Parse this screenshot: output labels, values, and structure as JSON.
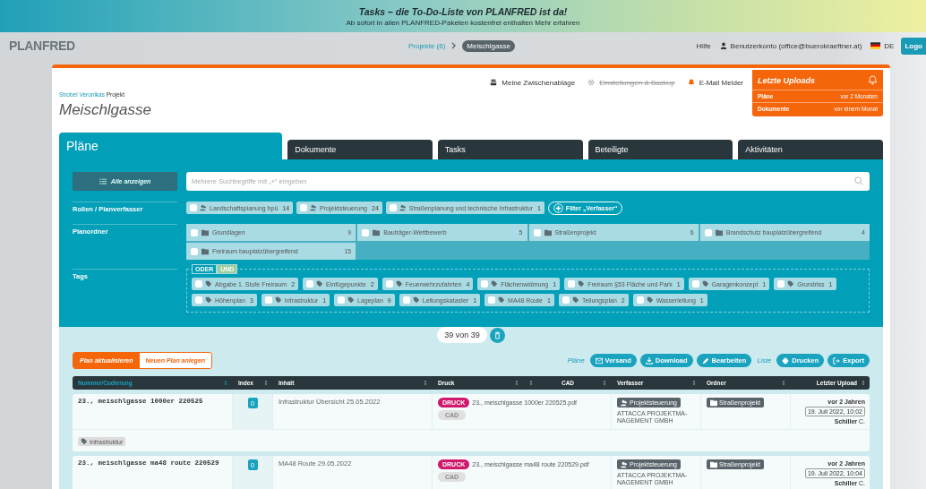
{
  "banner": {
    "title": "Tasks – die To-Do-Liste von PLANFRED ist da!",
    "text": "Ab sofort in allen PLANFRED-Paketen kostenfrei enthalten",
    "link": "Mehr erfahren"
  },
  "header": {
    "logo": "PLANFRED",
    "breadcrumb": {
      "link": "Projekte (6)",
      "current": "Meischlgasse"
    },
    "help": "Hilfe",
    "account": "Benutzerkonto (office@buerokraeftner.at)",
    "language": "DE",
    "logout": "Logo"
  },
  "toolbar": [
    {
      "label": "Meine Zwischenablage",
      "kind": "clipboard",
      "disabled": false
    },
    {
      "label": "Einstellungen & Backup",
      "kind": "gear",
      "disabled": true
    },
    {
      "label": "E-Mail Melder",
      "kind": "bell",
      "disabled": false
    }
  ],
  "uploads": {
    "title": "Letzte Uploads",
    "rows": [
      {
        "label": "Pläne",
        "value": "vor 2 Monaten"
      },
      {
        "label": "Dokumente",
        "value": "vor einem Monat"
      }
    ]
  },
  "project": {
    "owner": "Strobel Veronikas",
    "suffix": "Projekt",
    "title": "Meischlgasse"
  },
  "tabs": [
    {
      "label": "Pläne",
      "selected": true
    },
    {
      "label": "Dokumente",
      "selected": false
    },
    {
      "label": "Tasks",
      "selected": false
    },
    {
      "label": "Beteiligte",
      "selected": false
    },
    {
      "label": "Aktivitäten",
      "selected": false
    }
  ],
  "filters": {
    "show_all": "Alle anzeigen",
    "search": {
      "placeholder": "Mehrere Suchbegriffe mit „+“ eingeben"
    },
    "roles_label": "Rollen / Planverfasser",
    "roles": [
      {
        "label": "Landschaftsplanung bpü",
        "count": "14",
        "checked": false
      },
      {
        "label": "Projektsteuerung",
        "count": "24",
        "checked": false
      },
      {
        "label": "Straßenplanung und technische Infrastruktur",
        "count": "1",
        "checked": false
      }
    ],
    "roles_filter": "Filter „Verfasser“",
    "folders_label": "Planordner",
    "folders": [
      {
        "label": "Grundlagen",
        "count": "9",
        "checked": false
      },
      {
        "label": "Bauträger-Wettbewerb",
        "count": "5",
        "checked": false
      },
      {
        "label": "Straßenprojekt",
        "count": "6",
        "checked": false
      },
      {
        "label": "Brandschutz bauplatzübergreifend",
        "count": "4",
        "checked": false
      },
      {
        "label": "Freiraum bauplatzübergreifend",
        "count": "15",
        "checked": false
      }
    ],
    "tags_label": "Tags",
    "tag_modes": [
      {
        "label": "ODER",
        "selected": false
      },
      {
        "label": "UND",
        "selected": true
      }
    ],
    "tags": [
      {
        "label": "Abgabe 1. Stufe Freiraum",
        "count": "2",
        "checked": false
      },
      {
        "label": "Einfügepunkte",
        "count": "2",
        "checked": false
      },
      {
        "label": "Feuerwehrzufahrten",
        "count": "4",
        "checked": false
      },
      {
        "label": "Flächenwidmung",
        "count": "1",
        "checked": false
      },
      {
        "label": "Freiraum §53 Fläche und Park",
        "count": "1",
        "checked": false
      },
      {
        "label": "Garagenkonzept",
        "count": "1",
        "checked": false
      },
      {
        "label": "Grundriss",
        "count": "1",
        "checked": false
      },
      {
        "label": "Höhenplan",
        "count": "3",
        "checked": false
      },
      {
        "label": "Infrastruktur",
        "count": "1",
        "checked": false
      },
      {
        "label": "Lageplan",
        "count": "9",
        "checked": false
      },
      {
        "label": "Leitungskataster",
        "count": "1",
        "checked": false
      },
      {
        "label": "MA48 Route",
        "count": "1",
        "checked": false
      },
      {
        "label": "Teilungsplan",
        "count": "2",
        "checked": false
      },
      {
        "label": "Wasserleitung",
        "count": "1",
        "checked": false
      }
    ]
  },
  "result_count": "39 von 39",
  "plan_actions": [
    {
      "label": "Plan aktualisieren",
      "selected": true
    },
    {
      "label": "Neuen Plan anlegen",
      "selected": false
    }
  ],
  "action_groups": [
    {
      "label": "Pläne",
      "buttons": [
        {
          "label": "Versand",
          "kind": "mail"
        },
        {
          "label": "Download",
          "kind": "download"
        },
        {
          "label": "Bearbeiten",
          "kind": "edit"
        }
      ]
    },
    {
      "label": "Liste",
      "buttons": [
        {
          "label": "Drucken",
          "kind": "print"
        },
        {
          "label": "Export",
          "kind": "export"
        }
      ]
    }
  ],
  "table": {
    "columns": [
      {
        "label": "Nummer/Codierung",
        "sorted": true
      },
      {
        "label": "Index",
        "sorted": false
      },
      {
        "label": "Inhalt",
        "sorted": false
      },
      {
        "label": "Druck",
        "sorted": false
      },
      {
        "label": "CAD",
        "sorted": false
      },
      {
        "label": "Verfasser",
        "sorted": false
      },
      {
        "label": "Ordner",
        "sorted": false
      },
      {
        "label": "Letzter Upload",
        "sorted": false
      }
    ],
    "rows": [
      {
        "number": "23., meischlgasse 1000er 220525",
        "index": "0",
        "content": "Infrastruktur Übersicht 25.05.2022",
        "print_badge": "DRUCK",
        "print_file": "23., meischlgasse 1000er 220525.pdf",
        "cad_badge": "CAD",
        "cad_available": false,
        "role": "Projektsteuerung",
        "company": "ATTACCA PROJEKTMA-NAGEMENT GMBH",
        "folder": "Straßenprojekt",
        "ago": "vor 2 Jahren",
        "date": "19. Juli 2022, 10:02",
        "user": "Schiller",
        "initial": "C.",
        "tags": [
          "Infrastruktur"
        ]
      },
      {
        "number": "23., meischlgasse ma48 route 220529",
        "index": "0",
        "content": "MA48 Route 29.05.2022",
        "print_badge": "DRUCK",
        "print_file": "23., meischlgasse ma48 route 220529.pdf",
        "cad_badge": "CAD",
        "cad_available": false,
        "role": "Projektsteuerung",
        "company": "ATTACCA PROJEKTMA-NAGEMENT GMBH",
        "folder": "Straßenprojekt",
        "ago": "vor 2 Jahren",
        "date": "19. Juli 2022, 10:04",
        "user": "Schiller",
        "initial": "C.",
        "tags": []
      }
    ]
  }
}
